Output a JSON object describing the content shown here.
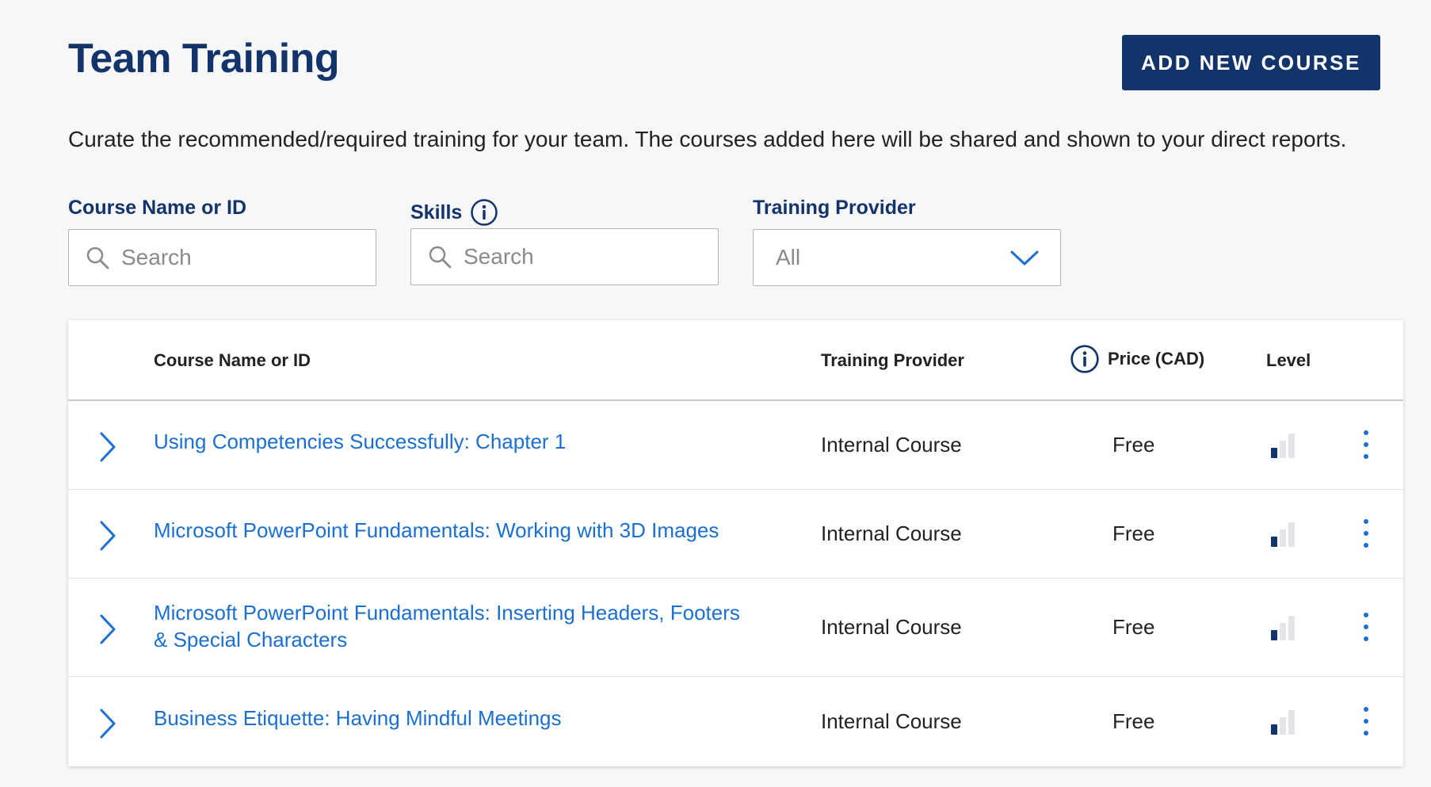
{
  "page": {
    "title": "Team Training",
    "add_button_label": "ADD NEW COURSE",
    "description": "Curate the recommended/required training for your team. The courses added here will be shared and shown to your direct reports."
  },
  "filters": {
    "course": {
      "label": "Course Name or ID",
      "placeholder": "Search",
      "value": ""
    },
    "skills": {
      "label": "Skills",
      "placeholder": "Search",
      "value": "",
      "icon": "info-icon"
    },
    "provider": {
      "label": "Training Provider",
      "selected": "All",
      "icon": "chevron-down-icon"
    }
  },
  "table": {
    "headers": {
      "course": "Course Name or ID",
      "provider": "Training Provider",
      "price": "Price (CAD)",
      "level": "Level"
    },
    "rows": [
      {
        "name": "Using Competencies Successfully: Chapter 1",
        "provider": "Internal Course",
        "price": "Free",
        "level": 1
      },
      {
        "name": "Microsoft PowerPoint Fundamentals: Working with 3D Images",
        "provider": "Internal Course",
        "price": "Free",
        "level": 1
      },
      {
        "name": "Microsoft PowerPoint Fundamentals: Inserting Headers, Footers & Special Characters",
        "provider": "Internal Course",
        "price": "Free",
        "level": 1
      },
      {
        "name": "Business Etiquette: Having Mindful Meetings",
        "provider": "Internal Course",
        "price": "Free",
        "level": 1
      }
    ],
    "level_max": 3
  },
  "colors": {
    "brand_navy": "#13346b",
    "link_blue": "#1a6fd1",
    "level_active": "#13346b",
    "level_inactive": "#e2e4e8"
  }
}
